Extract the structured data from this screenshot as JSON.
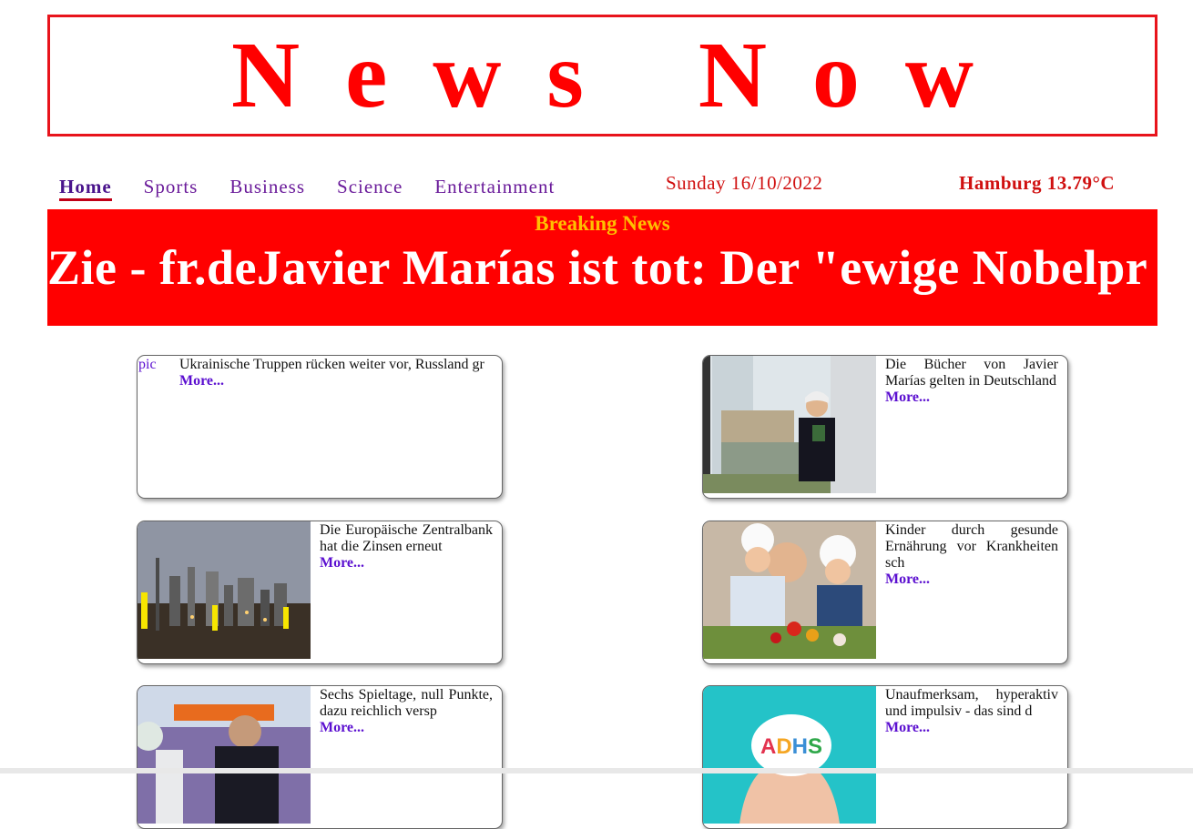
{
  "masthead": {
    "title": "News Now"
  },
  "nav": {
    "items": [
      "Home",
      "Sports",
      "Business",
      "Science",
      "Entertainment"
    ],
    "active": "Home"
  },
  "date": "Sunday 16/10/2022",
  "weather": "Hamburg 13.79°C",
  "breaking": {
    "label": "Breaking News",
    "ticker": "Zie - fr.deJavier Marías ist tot: Der \"ewige Nobelpr"
  },
  "colors": {
    "brand_red": "#ff0000",
    "breaking_label": "#ffc000",
    "link_purple": "#5b0fd0"
  },
  "articles": [
    {
      "text": "Ukrainische Truppen rücken weiter vor, Russland gr",
      "more": "More...",
      "image_alt": "pic"
    },
    {
      "text": "Die Bücher von Javier Marías gelten in Deutschland",
      "more": "More..."
    },
    {
      "text": "Die Europäische Zentralbank hat die Zinsen erneut",
      "more": "More..."
    },
    {
      "text": "Kinder durch gesunde Ernährung vor Krankheiten sch",
      "more": "More..."
    },
    {
      "text": "Sechs Spieltage, null Punkte, dazu reichlich versp",
      "more": "More..."
    },
    {
      "text": "Unaufmerksam, hyperaktiv und impulsiv - das sind d",
      "more": "More...",
      "image_label": "ADHS"
    }
  ]
}
